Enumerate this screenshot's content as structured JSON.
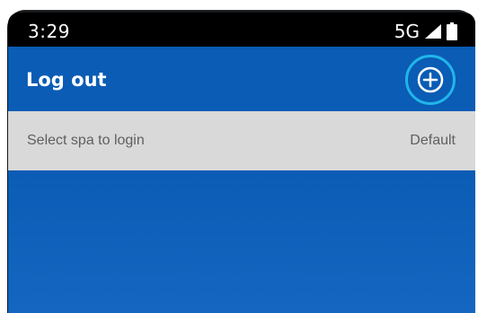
{
  "status_bar": {
    "time": "3:29",
    "network": "5G",
    "icons": [
      "signal-icon",
      "battery-icon"
    ]
  },
  "app_bar": {
    "title": "Log out",
    "action_icon": "add-circle-icon"
  },
  "settings_row": {
    "label": "Select spa to login",
    "value": "Default"
  },
  "colors": {
    "primary": "#0a5cb5",
    "focus_ring": "#21b5ea",
    "row_background": "#d9d9d9",
    "row_text": "#5f5f5f",
    "status_bar": "#000000"
  }
}
